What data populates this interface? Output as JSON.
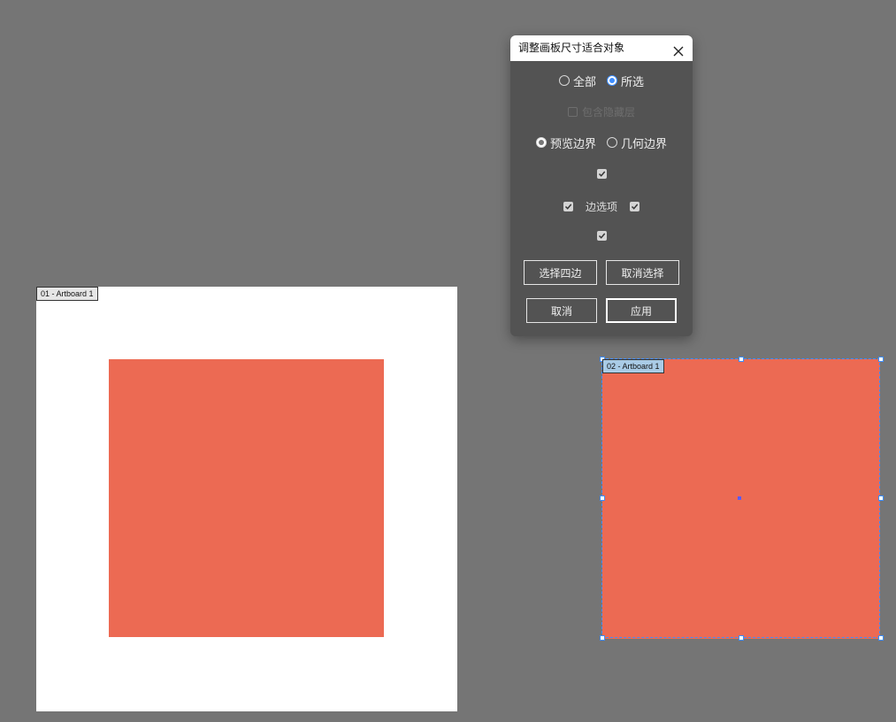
{
  "canvas": {
    "artboard1_label": "01 - Artboard 1",
    "artboard2_label": "02 - Artboard 1",
    "shape_color": "#ec6a53",
    "selection_color": "#3d8dff",
    "background_color": "#757575"
  },
  "dialog": {
    "title": "调整画板尺寸适合对象",
    "scope": {
      "all_label": "全部",
      "selected_label": "所选",
      "selected": "所选"
    },
    "include_hidden_label": "包含隐藏层",
    "bounds": {
      "preview_label": "预览边界",
      "geometric_label": "几何边界",
      "selected": "预览边界"
    },
    "edge_options_label": "边选项",
    "edges": {
      "top": true,
      "left": true,
      "right": true,
      "bottom": true
    },
    "buttons": {
      "select_all_edges": "选择四边",
      "deselect": "取消选择",
      "cancel": "取消",
      "apply": "应用"
    }
  }
}
